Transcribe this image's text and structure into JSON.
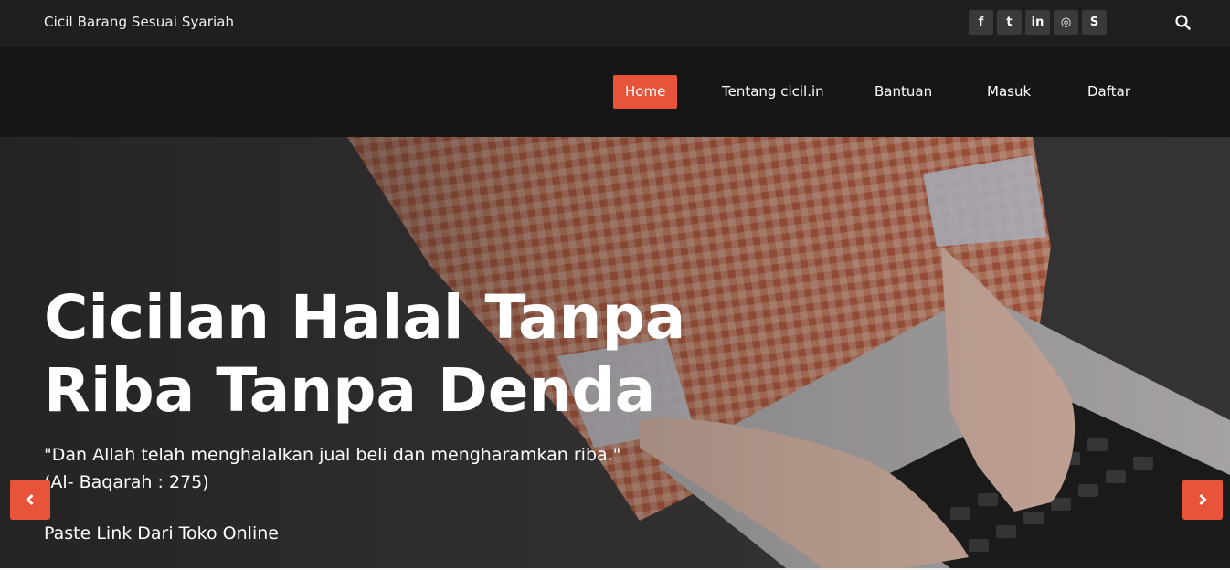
{
  "topbar": {
    "tagline": "Cicil Barang Sesuai Syariah",
    "social": [
      {
        "icon": "facebook-icon",
        "glyph": "f"
      },
      {
        "icon": "twitter-icon",
        "glyph": "t"
      },
      {
        "icon": "linkedin-icon",
        "glyph": "in"
      },
      {
        "icon": "dribbble-icon",
        "glyph": "◎"
      },
      {
        "icon": "skype-icon",
        "glyph": "S"
      }
    ],
    "search_icon": "search-icon"
  },
  "nav": {
    "items": [
      {
        "label": "Home",
        "active": true
      },
      {
        "label": "Tentang cicil.in",
        "active": false
      },
      {
        "label": "Bantuan",
        "active": false
      },
      {
        "label": "Masuk",
        "active": false
      },
      {
        "label": "Daftar",
        "active": false
      }
    ]
  },
  "hero": {
    "title_line1": "Cicilan Halal Tanpa",
    "title_line2": "Riba Tanpa Denda",
    "quote_line1": "\"Dan Allah telah menghalalkan jual beli dan mengharamkan riba.\"",
    "quote_line2": "(Al- Baqarah : 275)",
    "cta": "Paste Link Dari Toko Online",
    "prev_icon": "chevron-left-icon",
    "next_icon": "chevron-right-icon"
  },
  "colors": {
    "accent": "#e8543a",
    "topbar": "#1f1f1f",
    "navbar": "#161616"
  }
}
